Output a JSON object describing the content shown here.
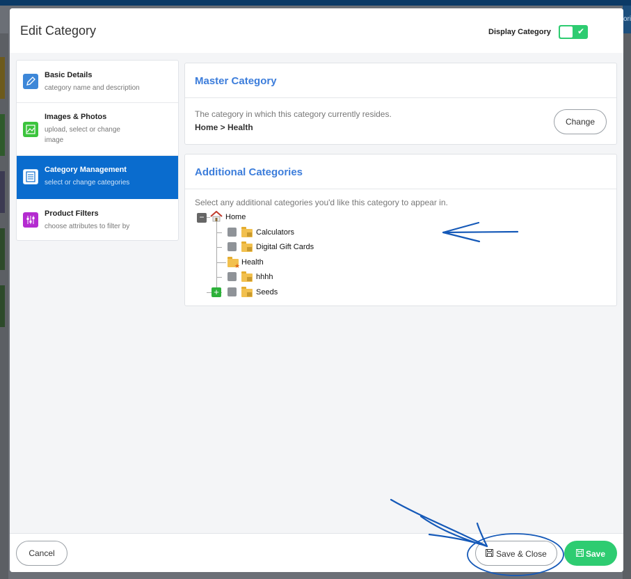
{
  "header": {
    "title": "Edit Category",
    "display_label": "Display Category",
    "display_enabled": true,
    "background_tab_partial": "ori"
  },
  "nav": [
    {
      "title": "Basic Details",
      "desc": "category name and description",
      "icon": "pencil-icon",
      "color": "#3d87d8",
      "active": false
    },
    {
      "title": "Images & Photos",
      "desc": "upload, select or change image",
      "icon": "image-icon",
      "color": "#3cc43d",
      "active": false
    },
    {
      "title": "Category Management",
      "desc": "select or change categories",
      "icon": "list-icon",
      "color": "#ffffff",
      "active": true
    },
    {
      "title": "Product Filters",
      "desc": "choose attributes to filter by",
      "icon": "sliders-icon",
      "color": "#b42bd0",
      "active": false
    }
  ],
  "master": {
    "title": "Master Category",
    "desc": "The category in which this category currently resides.",
    "path": "Home > Health",
    "change_label": "Change"
  },
  "additional": {
    "title": "Additional Categories",
    "desc": "Select any additional categories you'd like this category to appear in.",
    "tree": {
      "root": "Home",
      "children": [
        "Calculators",
        "Digital Gift Cards",
        "Health",
        "hhhh",
        "Seeds"
      ]
    }
  },
  "footer": {
    "cancel_label": "Cancel",
    "save_close_label": "Save & Close",
    "save_label": "Save"
  },
  "colors": {
    "accent": "#0a6cce",
    "success": "#2ecc71",
    "title_blue": "#3c7ddb",
    "annotation": "#1559b8"
  }
}
